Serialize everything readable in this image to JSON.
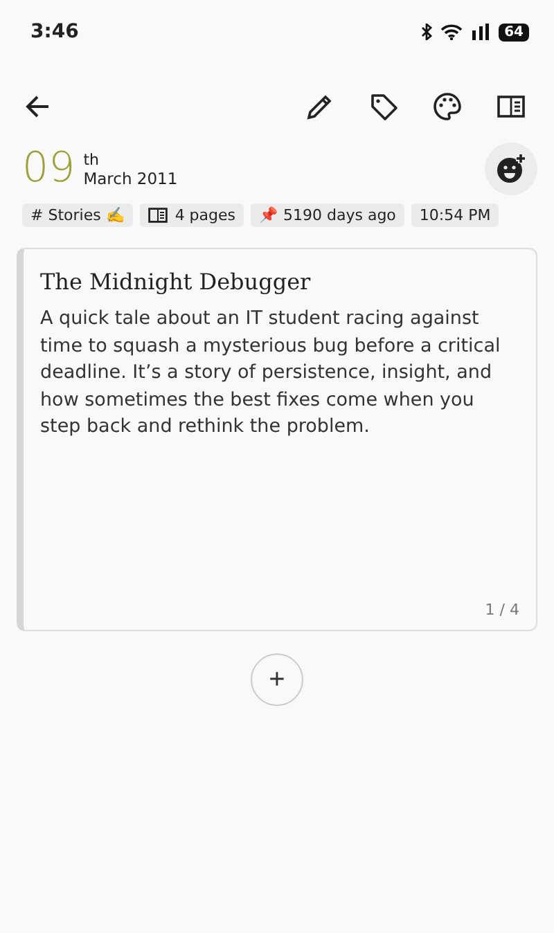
{
  "status_bar": {
    "time": "3:46",
    "battery": "64"
  },
  "date": {
    "day": "09",
    "suffix": "th",
    "month_year": "March 2011"
  },
  "chips": [
    {
      "kind": "text",
      "label": "# Stories ✍️"
    },
    {
      "kind": "pages",
      "label": "4 pages"
    },
    {
      "kind": "text",
      "label": "📌 5190 days ago"
    },
    {
      "kind": "text",
      "label": "10:54 PM"
    }
  ],
  "note": {
    "title": "The Midnight Debugger",
    "body": "A quick tale about an IT student racing against time to squash a mysterious bug before a critical deadline. It’s a story of persistence, insight, and how sometimes the best fixes come when you step back and rethink the problem.",
    "page_indicator": "1 / 4"
  },
  "add_button": "+"
}
